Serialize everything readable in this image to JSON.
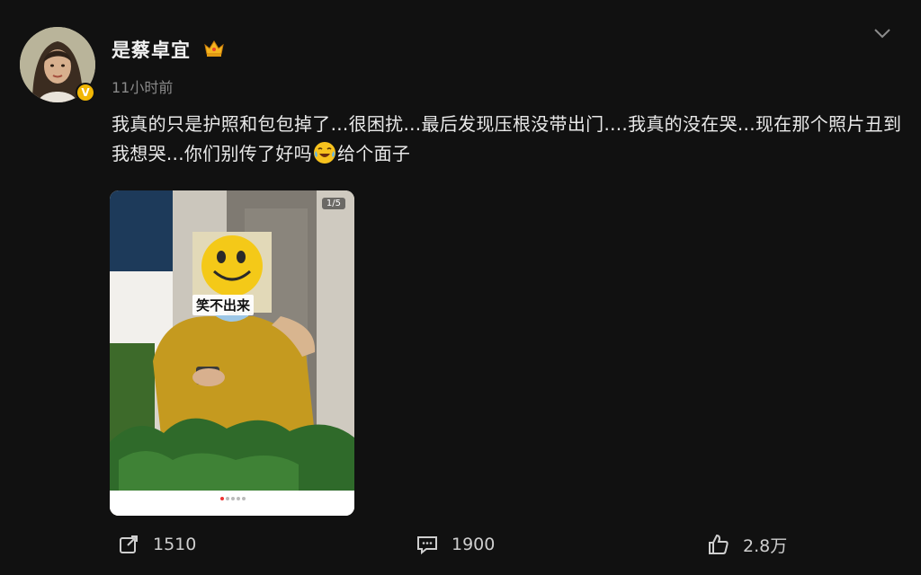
{
  "post": {
    "author": "是蔡卓宜",
    "time": "11小时前",
    "verified_mark": "V",
    "text_part1": "我真的只是护照和包包掉了...很困扰...最后发现压根没带出门....我真的没在哭...现在那个照片丑到我想哭...你们别传了好吗",
    "text_part2": "给个面子",
    "photo": {
      "counter": "1/5",
      "sticker_caption": "笑不出来"
    },
    "actions": {
      "reposts": "1510",
      "comments": "1900",
      "likes": "2.8万"
    },
    "icons": [
      "crown-icon",
      "chevron-down-icon",
      "crying-laughing-emoji-icon",
      "repost-icon",
      "comment-icon",
      "like-icon"
    ],
    "colors": {
      "background": "#111111",
      "text": "#e9e9e9",
      "muted": "#8a8a8a",
      "verified": "#f2b705"
    }
  }
}
